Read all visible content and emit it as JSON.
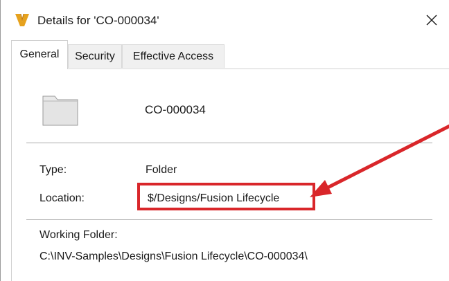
{
  "window": {
    "title": "Details for 'CO-000034'",
    "app_icon": "vault-v-logo-icon",
    "close_icon": "close-icon",
    "close_glyph": "✕"
  },
  "tabs": [
    {
      "label": "General",
      "active": true
    },
    {
      "label": "Security",
      "active": false
    },
    {
      "label": "Effective Access",
      "active": false
    }
  ],
  "general": {
    "folder_icon": "folder-icon",
    "name": "CO-000034",
    "type_label": "Type:",
    "type_value": "Folder",
    "location_label": "Location:",
    "location_value": "$/Designs/Fusion Lifecycle",
    "working_folder_label": "Working Folder:",
    "working_folder_value": "C:\\INV-Samples\\Designs\\Fusion Lifecycle\\CO-000034\\"
  },
  "annotation": {
    "highlight_color": "#d9262a",
    "arrow_icon": "red-arrow-icon"
  }
}
